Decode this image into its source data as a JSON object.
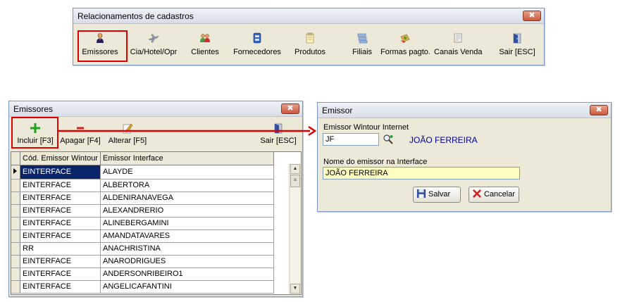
{
  "ribbon": {
    "title": "Relacionamentos de cadastros",
    "close_label": "✖",
    "items": [
      {
        "label": "Emissores",
        "icon": "person-icon"
      },
      {
        "label": "Cia/Hotel/Opr",
        "icon": "airplane-icon"
      },
      {
        "label": "Clientes",
        "icon": "people-icon"
      },
      {
        "label": "Fornecedores",
        "icon": "building-icon"
      },
      {
        "label": "Produtos",
        "icon": "product-icon"
      },
      {
        "label": "Filiais",
        "icon": "branches-icon"
      },
      {
        "label": "Formas pagto.",
        "icon": "payment-icon"
      },
      {
        "label": "Canais Venda",
        "icon": "sales-channel-icon"
      },
      {
        "label": "Sair [ESC]",
        "icon": "exit-door-icon"
      }
    ]
  },
  "emissores": {
    "title": "Emissores",
    "close_label": "✖",
    "toolbar": {
      "incluir": "Incluir [F3]",
      "apagar": "Apagar [F4]",
      "alterar": "Alterar [F5]",
      "sair": "Sair [ESC]"
    },
    "columns": [
      "Cód. Emissor Wintour",
      "Emissor Interface"
    ],
    "rows": [
      [
        "EINTERFACE",
        "ALAYDE"
      ],
      [
        "EINTERFACE",
        "ALBERTORA"
      ],
      [
        "EINTERFACE",
        "ALDENIRANAVEGA"
      ],
      [
        "EINTERFACE",
        "ALEXANDRERIO"
      ],
      [
        "EINTERFACE",
        "ALINEBERGAMINI"
      ],
      [
        "EINTERFACE",
        "AMANDATAVARES"
      ],
      [
        "RR",
        "ANACHRISTINA"
      ],
      [
        "EINTERFACE",
        "ANARODRIGUES"
      ],
      [
        "EINTERFACE",
        "ANDERSONRIBEIRO1"
      ],
      [
        "EINTERFACE",
        "ANGELICAFANTINI"
      ]
    ]
  },
  "emissor": {
    "title": "Emissor",
    "close_label": "✖",
    "wintour_label": "Emissor Wintour Internet",
    "wintour_code": "JF",
    "wintour_name": "JOÃO FERREIRA",
    "interface_label": "Nome do emissor na Interface",
    "interface_value": "JOÃO FERREIRA",
    "save_label": "Salvar",
    "cancel_label": "Cancelar"
  },
  "colors": {
    "highlight": "#e00000",
    "selection": "#0a246a",
    "input_yellow": "#ffffc0",
    "name_blue": "#0000a0"
  }
}
